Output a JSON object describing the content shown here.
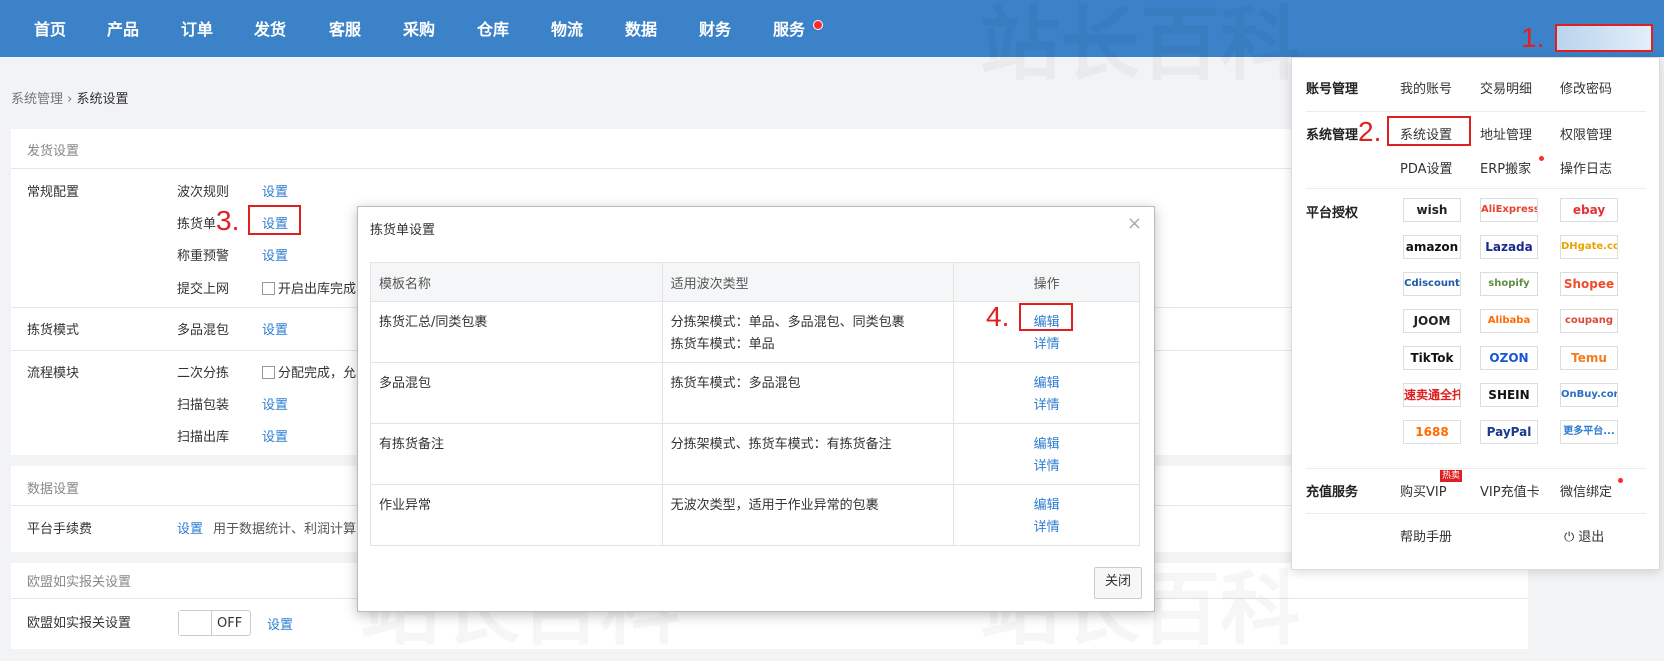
{
  "nav": {
    "items": [
      "首页",
      "产品",
      "订单",
      "发货",
      "客服",
      "采购",
      "仓库",
      "物流",
      "数据",
      "财务",
      "服务"
    ]
  },
  "annotations": {
    "a1": "1.",
    "a2": "2.",
    "a3": "3.",
    "a4": "4."
  },
  "breadcrumb": {
    "parent": "系统管理",
    "sep": "›",
    "current": "系统设置"
  },
  "shipping": {
    "title": "发货设置",
    "general_label": "常规配置",
    "rules": [
      {
        "name": "波次规则",
        "action": "设置"
      },
      {
        "name": "拣货单",
        "action": "设置"
      },
      {
        "name": "称重预警",
        "action": "设置"
      },
      {
        "name": "提交上网",
        "option": "开启出库完成"
      }
    ],
    "pick_mode_label": "拣货模式",
    "pick_mode_name": "多品混包",
    "pick_mode_action": "设置",
    "flow_label": "流程模块",
    "flow": [
      {
        "name": "二次分拣",
        "option": "分配完成，允"
      },
      {
        "name": "扫描包装",
        "action": "设置"
      },
      {
        "name": "扫描出库",
        "action": "设置"
      }
    ]
  },
  "data_settings": {
    "title": "数据设置",
    "fee_label": "平台手续费",
    "fee_action": "设置",
    "fee_desc": "用于数据统计、利润计算"
  },
  "eu": {
    "title": "欧盟如实报关设置",
    "label": "欧盟如实报关设置",
    "toggle_state": "OFF",
    "action": "设置"
  },
  "modal": {
    "title": "拣货单设置",
    "close_icon": "×",
    "headers": [
      "模板名称",
      "适用波次类型",
      "操作"
    ],
    "rows": [
      {
        "name": "拣货汇总/同类包裹",
        "types": [
          "分拣架模式：单品、多品混包、同类包裹",
          "拣货车模式：单品"
        ],
        "edit": "编辑",
        "detail": "详情"
      },
      {
        "name": "多品混包",
        "types": [
          "拣货车模式：多品混包"
        ],
        "edit": "编辑",
        "detail": "详情"
      },
      {
        "name": "有拣货备注",
        "types": [
          "分拣架模式、拣货车模式：有拣货备注"
        ],
        "edit": "编辑",
        "detail": "详情"
      },
      {
        "name": "作业异常",
        "types": [
          "无波次类型，适用于作业异常的包裹"
        ],
        "edit": "编辑",
        "detail": "详情"
      }
    ],
    "close_button": "关闭"
  },
  "menu": {
    "account": {
      "head": "账号管理",
      "items": [
        "我的账号",
        "交易明细",
        "修改密码"
      ]
    },
    "system": {
      "head": "系统管理",
      "items": [
        "系统设置",
        "地址管理",
        "权限管理",
        "PDA设置",
        "ERP搬家",
        "操作日志"
      ]
    },
    "platform": {
      "head": "平台授权",
      "logos": [
        {
          "text": "wish",
          "color": "#222222"
        },
        {
          "text": "AliExpress",
          "color": "#e8432e"
        },
        {
          "text": "ebay",
          "color": "#e53238"
        },
        {
          "text": "amazon",
          "color": "#111111"
        },
        {
          "text": "Lazada",
          "color": "#1a2a8c"
        },
        {
          "text": "DHgate.com",
          "color": "#e8a400"
        },
        {
          "text": "Cdiscount",
          "color": "#1d5aa8"
        },
        {
          "text": "shopify",
          "color": "#5e8e3e"
        },
        {
          "text": "Shopee",
          "color": "#ee4d2d"
        },
        {
          "text": "JOOM",
          "color": "#222222"
        },
        {
          "text": "Alibaba",
          "color": "#ff6a00"
        },
        {
          "text": "coupang",
          "color": "#d64b3a"
        },
        {
          "text": "TikTok",
          "color": "#111111"
        },
        {
          "text": "OZON",
          "color": "#1756d1"
        },
        {
          "text": "Temu",
          "color": "#f47b20"
        },
        {
          "text": "速卖通全托管",
          "color": "#e02020"
        },
        {
          "text": "SHEIN",
          "color": "#111111"
        },
        {
          "text": "OnBuy.com",
          "color": "#2a6ec4"
        },
        {
          "text": "1688",
          "color": "#ff6a00"
        },
        {
          "text": "PayPal",
          "color": "#1a3a8c"
        },
        {
          "text": "更多平台...",
          "color": "#2d7dd2"
        }
      ]
    },
    "recharge": {
      "head": "充值服务",
      "items": [
        "购买VIP",
        "VIP充值卡",
        "微信绑定"
      ],
      "hot": "热卖"
    },
    "help": "帮助手册",
    "logout": "退出"
  },
  "watermark": "站长百科"
}
